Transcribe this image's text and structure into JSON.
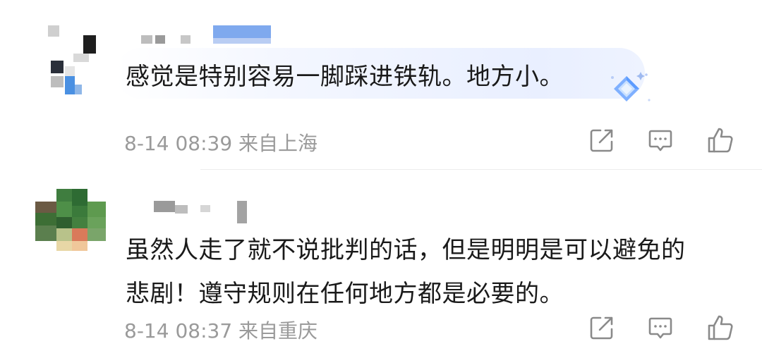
{
  "comments": [
    {
      "text_lines": [
        "感觉是特别容易一脚踩进铁轨。地方小。"
      ],
      "time": "8-14 08:39",
      "location": "来自上海",
      "highlight_bubble": true
    },
    {
      "text_lines": [
        "虽然人走了就不说批判的话，但是明明是可以避免的",
        "悲剧！遵守规则在任何地方都是必要的。"
      ],
      "time": "8-14 08:37",
      "location": "来自重庆",
      "highlight_bubble": false
    }
  ],
  "icons": {
    "share": "share-icon",
    "reply": "comment-icon",
    "like": "thumbs-up-icon",
    "badge": "diamond-badge-icon"
  },
  "colors": {
    "text": "#1a1a1a",
    "meta": "#9a9a9a",
    "icon": "#8a8a8a",
    "bubble": "#e9efff",
    "badge": "#5b9bff"
  }
}
